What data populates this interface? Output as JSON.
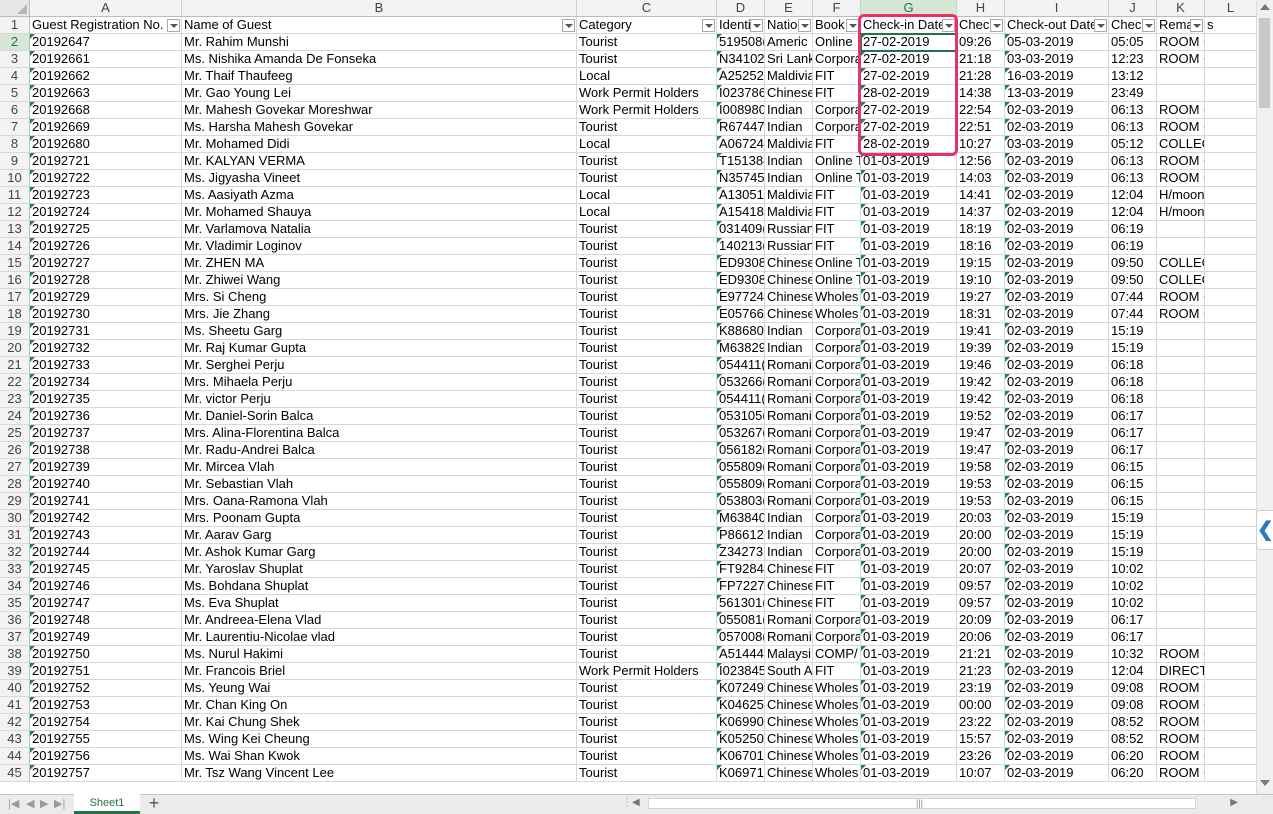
{
  "app": {
    "active_cell": "G2",
    "selected_column": "G",
    "selected_row": 2
  },
  "column_letters": [
    "A",
    "B",
    "C",
    "D",
    "E",
    "F",
    "G",
    "H",
    "I",
    "J",
    "K",
    "L"
  ],
  "header_row": [
    "Guest Registration No.",
    "Name of Guest",
    "Category",
    "Identi",
    "Natio",
    "Book",
    "Check-in Date",
    "Chec",
    "Check-out Date",
    "Chec",
    "Rema",
    "s"
  ],
  "first_row_number": 2,
  "rows": [
    [
      "20192647",
      "Mr. Rahim Munshi",
      "Tourist",
      "519508(",
      "Americ",
      "Online",
      "27-02-2019",
      "09:26",
      "05-03-2019",
      "05:05",
      "ROOM + BREA",
      ""
    ],
    [
      "20192661",
      "Ms. Nishika Amanda De Fonseka",
      "Tourist",
      "N34102",
      "Sri Lank",
      "Corpora",
      "27-02-2019",
      "21:18",
      "03-03-2019",
      "12:23",
      "ROOM + BREA",
      ""
    ],
    [
      "20192662",
      "Mr. Thaif Thaufeeg",
      "Local",
      "A25252",
      "Maldivia",
      "FIT",
      "27-02-2019",
      "21:28",
      "16-03-2019",
      "13:12",
      "",
      ""
    ],
    [
      "20192663",
      "Mr. Gao Young Lei",
      "Work Permit Holders",
      "I023786",
      "Chinese",
      "FIT",
      "28-02-2019",
      "14:38",
      "13-03-2019",
      "23:49",
      "",
      ""
    ],
    [
      "20192668",
      "Mr. Mahesh Govekar Moreshwar",
      "Work Permit Holders",
      "I008980",
      "Indian",
      "Corpora",
      "27-02-2019",
      "22:54",
      "02-03-2019",
      "06:13",
      "ROOM + BREA",
      ""
    ],
    [
      "20192669",
      "Ms. Harsha Mahesh Govekar",
      "Tourist",
      "R67447",
      "Indian",
      "Corpora",
      "27-02-2019",
      "22:51",
      "02-03-2019",
      "06:13",
      "ROOM + BREA",
      ""
    ],
    [
      "20192680",
      "Mr. Mohamed Didi",
      "Local",
      "A06724",
      "Maldivia",
      "FIT",
      "28-02-2019",
      "10:27",
      "03-03-2019",
      "05:12",
      "COLLECT THE I",
      ""
    ],
    [
      "20192721",
      "Mr. KALYAN VERMA",
      "Tourist",
      "T151384",
      "Indian",
      "Online T",
      "01-03-2019",
      "12:56",
      "02-03-2019",
      "06:13",
      "ROOM + BREA",
      ""
    ],
    [
      "20192722",
      "Ms. Jigyasha Vineet",
      "Tourist",
      "N35745",
      "Indian",
      "Online T",
      "01-03-2019",
      "14:03",
      "02-03-2019",
      "06:13",
      "ROOM + BREA",
      ""
    ],
    [
      "20192723",
      "Ms. Aasiyath Azma",
      "Local",
      "A13051",
      "Maldivia",
      "FIT",
      "01-03-2019",
      "14:41",
      "02-03-2019",
      "12:04",
      "H/mooners",
      ""
    ],
    [
      "20192724",
      "Mr. Mohamed Shauya",
      "Local",
      "A15418",
      "Maldivia",
      "FIT",
      "01-03-2019",
      "14:37",
      "02-03-2019",
      "12:04",
      "H/mooners",
      ""
    ],
    [
      "20192725",
      "Mr. Varlamova Natalia",
      "Tourist",
      "031409(",
      "Russian",
      "FIT",
      "01-03-2019",
      "18:19",
      "02-03-2019",
      "06:19",
      "",
      ""
    ],
    [
      "20192726",
      "Mr. Vladimir Loginov",
      "Tourist",
      "140213(",
      "Russian",
      "FIT",
      "01-03-2019",
      "18:16",
      "02-03-2019",
      "06:19",
      "",
      ""
    ],
    [
      "20192727",
      "Mr. ZHEN MA",
      "Tourist",
      "ED9308",
      "Chinese",
      "Online T",
      "01-03-2019",
      "19:15",
      "02-03-2019",
      "09:50",
      "COLLECT THE I",
      ""
    ],
    [
      "20192728",
      "Mr. Zhiwei Wang",
      "Tourist",
      "ED9308",
      "Chinese",
      "Online T",
      "01-03-2019",
      "19:10",
      "02-03-2019",
      "09:50",
      "COLLECT THE I",
      ""
    ],
    [
      "20192729",
      "Mrs. Si Cheng",
      "Tourist",
      "E97724",
      "Chinese",
      "Wholes",
      "01-03-2019",
      "19:27",
      "02-03-2019",
      "07:44",
      "ROOM + BREA",
      ""
    ],
    [
      "20192730",
      "Mrs. Jie Zhang",
      "Tourist",
      "E05766",
      "Chinese",
      "Wholes",
      "01-03-2019",
      "18:31",
      "02-03-2019",
      "07:44",
      "ROOM + BREA",
      ""
    ],
    [
      "20192731",
      "Ms. Sheetu Garg",
      "Tourist",
      "K88680",
      "Indian",
      "Corpora",
      "01-03-2019",
      "19:41",
      "02-03-2019",
      "15:19",
      "",
      ""
    ],
    [
      "20192732",
      "Mr. Raj Kumar Gupta",
      "Tourist",
      "M63829",
      "Indian",
      "Corpora",
      "01-03-2019",
      "19:39",
      "02-03-2019",
      "15:19",
      "",
      ""
    ],
    [
      "20192733",
      "Mr. Serghei Perju",
      "Tourist",
      "054411(",
      "Romani",
      "Corpora",
      "01-03-2019",
      "19:46",
      "02-03-2019",
      "06:18",
      "",
      ""
    ],
    [
      "20192734",
      "Mrs. Mihaela Perju",
      "Tourist",
      "053266(",
      "Romani",
      "Corpora",
      "01-03-2019",
      "19:42",
      "02-03-2019",
      "06:18",
      "",
      ""
    ],
    [
      "20192735",
      "Mr. victor Perju",
      "Tourist",
      "054411(",
      "Romani",
      "Corpora",
      "01-03-2019",
      "19:42",
      "02-03-2019",
      "06:18",
      "",
      ""
    ],
    [
      "20192736",
      "Mr. Daniel-Sorin Balca",
      "Tourist",
      "053105(",
      "Romani",
      "Corpora",
      "01-03-2019",
      "19:52",
      "02-03-2019",
      "06:17",
      "",
      ""
    ],
    [
      "20192737",
      "Mrs. Alina-Florentina Balca",
      "Tourist",
      "053267(",
      "Romani",
      "Corpora",
      "01-03-2019",
      "19:47",
      "02-03-2019",
      "06:17",
      "",
      ""
    ],
    [
      "20192738",
      "Mr. Radu-Andrei Balca",
      "Tourist",
      "056182(",
      "Romani",
      "Corpora",
      "01-03-2019",
      "19:47",
      "02-03-2019",
      "06:17",
      "",
      ""
    ],
    [
      "20192739",
      "Mr. Mircea Vlah",
      "Tourist",
      "055809(",
      "Romani",
      "Corpora",
      "01-03-2019",
      "19:58",
      "02-03-2019",
      "06:15",
      "",
      ""
    ],
    [
      "20192740",
      "Mr. Sebastian Vlah",
      "Tourist",
      "055809(",
      "Romani",
      "Corpora",
      "01-03-2019",
      "19:53",
      "02-03-2019",
      "06:15",
      "",
      ""
    ],
    [
      "20192741",
      "Mrs. Oana-Ramona Vlah",
      "Tourist",
      "053803(",
      "Romani",
      "Corpora",
      "01-03-2019",
      "19:53",
      "02-03-2019",
      "06:15",
      "",
      ""
    ],
    [
      "20192742",
      "Mrs. Poonam Gupta",
      "Tourist",
      "M63840",
      "Indian",
      "Corpora",
      "01-03-2019",
      "20:03",
      "02-03-2019",
      "15:19",
      "",
      ""
    ],
    [
      "20192743",
      "Mr. Aarav Garg",
      "Tourist",
      "P86612",
      "Indian",
      "Corpora",
      "01-03-2019",
      "20:00",
      "02-03-2019",
      "15:19",
      "",
      ""
    ],
    [
      "20192744",
      "Mr. Ashok Kumar Garg",
      "Tourist",
      "Z34273",
      "Indian",
      "Corpora",
      "01-03-2019",
      "20:00",
      "02-03-2019",
      "15:19",
      "",
      ""
    ],
    [
      "20192745",
      "Mr. Yaroslav Shuplat",
      "Tourist",
      "FT9284",
      "Chinese",
      "FIT",
      "01-03-2019",
      "20:07",
      "02-03-2019",
      "10:02",
      "",
      ""
    ],
    [
      "20192746",
      "Ms. Bohdana Shuplat",
      "Tourist",
      "FP7227",
      "Chinese",
      "FIT",
      "01-03-2019",
      "09:57",
      "02-03-2019",
      "10:02",
      "",
      ""
    ],
    [
      "20192747",
      "Ms. Eva Shuplat",
      "Tourist",
      "561301(",
      "Chinese",
      "FIT",
      "01-03-2019",
      "09:57",
      "02-03-2019",
      "10:02",
      "",
      ""
    ],
    [
      "20192748",
      "Mr. Andreea-Elena Vlad",
      "Tourist",
      "055081(",
      "Romani",
      "Corpora",
      "01-03-2019",
      "20:09",
      "02-03-2019",
      "06:17",
      "",
      ""
    ],
    [
      "20192749",
      "Mr. Laurentiu-Nicolae vlad",
      "Tourist",
      "057008(",
      "Romani",
      "Corpora",
      "01-03-2019",
      "20:06",
      "02-03-2019",
      "06:17",
      "",
      ""
    ],
    [
      "20192750",
      "Ms. Nurul Hakimi",
      "Tourist",
      "A51444",
      "Malaysi",
      "COMP/",
      "01-03-2019",
      "21:21",
      "02-03-2019",
      "10:32",
      "ROOM + BREA",
      ""
    ],
    [
      "20192751",
      "Mr. Francois Briel",
      "Work Permit Holders",
      "I023845",
      "South A",
      "FIT",
      "01-03-2019",
      "21:23",
      "02-03-2019",
      "12:04",
      "DIRECT PAYME",
      ""
    ],
    [
      "20192752",
      "Ms. Yeung Wai",
      "Tourist",
      "K07249",
      "Chinese",
      "Wholes",
      "01-03-2019",
      "23:19",
      "02-03-2019",
      "09:08",
      "ROOM + B/FAS",
      ""
    ],
    [
      "20192753",
      "Mr. Chan King On",
      "Tourist",
      "K04625",
      "Chinese",
      "Wholes",
      "01-03-2019",
      "00:00",
      "02-03-2019",
      "09:08",
      "ROOM + B/FAS",
      ""
    ],
    [
      "20192754",
      "Mr. Kai Chung Shek",
      "Tourist",
      "K06990",
      "Chinese",
      "Wholes",
      "01-03-2019",
      "23:22",
      "02-03-2019",
      "08:52",
      "ROOM + B/FAS",
      ""
    ],
    [
      "20192755",
      "Ms. Wing Kei Cheung",
      "Tourist",
      "K05250",
      "Chinese",
      "Wholes",
      "01-03-2019",
      "15:57",
      "02-03-2019",
      "08:52",
      "ROOM + B/FAS",
      ""
    ],
    [
      "20192756",
      "Ms. Wai Shan Kwok",
      "Tourist",
      "K06701",
      "Chinese",
      "Wholes",
      "01-03-2019",
      "23:26",
      "02-03-2019",
      "06:20",
      "ROOM + BREA",
      ""
    ],
    [
      "20192757",
      "Mr. Tsz Wang Vincent Lee",
      "Tourist",
      "K06971",
      "Chinese",
      "Wholes",
      "01-03-2019",
      "10:07",
      "02-03-2019",
      "06:20",
      "ROOM + BREA",
      ""
    ]
  ],
  "footer": {
    "sheet_tab": "Sheet1",
    "add_sheet": "+",
    "nav_first": "|◀",
    "nav_prev": "◀",
    "nav_next": "▶",
    "nav_last": "▶|"
  },
  "side_tab_glyph": "❮",
  "colors": {
    "excel_green": "#217346",
    "highlight_box": "#e5326a",
    "selected_header_bg": "#d6e8d4"
  },
  "icons": [
    "filter-dropdown-icon",
    "add-sheet-icon",
    "scroll-arrow-icon",
    "collapse-pane-icon"
  ]
}
